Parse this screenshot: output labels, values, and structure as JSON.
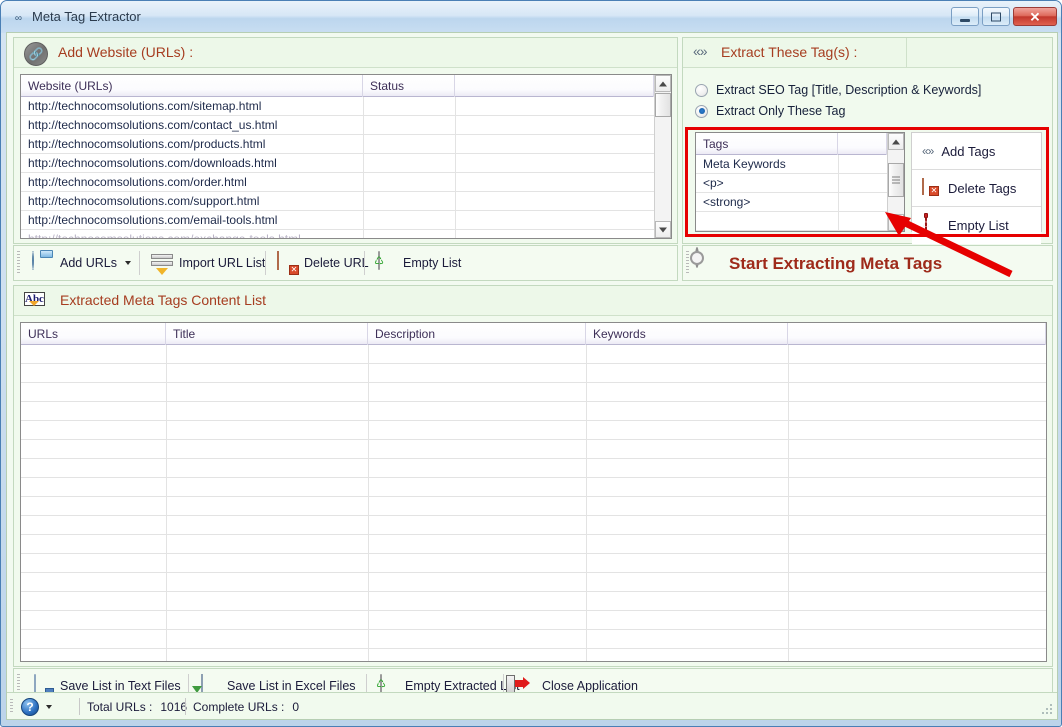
{
  "window": {
    "title": "Meta Tag Extractor",
    "title_icon": "app-icon",
    "minimize_label": "",
    "maximize_label": "",
    "close_label": "✕"
  },
  "add_website": {
    "header": "Add Website (URLs) :",
    "header_icon": "link-icon",
    "columns": [
      "Website (URLs)",
      "Status",
      ""
    ],
    "rows": [
      "http://technocomsolutions.com/sitemap.html",
      "http://technocomsolutions.com/contact_us.html",
      "http://technocomsolutions.com/products.html",
      "http://technocomsolutions.com/downloads.html",
      "http://technocomsolutions.com/order.html",
      "http://technocomsolutions.com/support.html",
      "http://technocomsolutions.com/email-tools.html",
      "http://technocomsolutions.com/exchange-tools.html"
    ]
  },
  "url_toolbar": {
    "items": [
      {
        "label": "Add URLs",
        "icon": "globe-add-icon",
        "has_caret": true
      },
      {
        "label": "Import URL List",
        "icon": "import-icon",
        "has_caret": false
      },
      {
        "label": "Delete URL",
        "icon": "delete-table-icon",
        "has_caret": false
      },
      {
        "label": "Empty List",
        "icon": "recycle-bin-icon",
        "has_caret": false
      }
    ]
  },
  "extract_tags": {
    "header": "Extract These Tag(s) :",
    "header_icon": "code-brackets-icon",
    "radios": [
      {
        "label": "Extract SEO Tag [Title, Description & Keywords]",
        "selected": false
      },
      {
        "label": "Extract Only These Tag",
        "selected": true
      }
    ],
    "tags_grid": {
      "columns": [
        "Tags",
        ""
      ],
      "rows": [
        "Meta Keywords",
        "<p>",
        "<strong>"
      ]
    },
    "buttons": [
      {
        "label": "Add Tags",
        "icon": "code-brackets-icon"
      },
      {
        "label": "Delete Tags",
        "icon": "delete-table-icon"
      },
      {
        "label": "Empty List",
        "icon": "trash-icon"
      }
    ]
  },
  "start_button": {
    "label": "Start Extracting Meta Tags",
    "icon": "gear-icon"
  },
  "extracted_list": {
    "header": "Extracted Meta Tags Content List",
    "header_icon": "abc-icon",
    "columns": [
      "URLs",
      "Title",
      "Description",
      "Keywords",
      ""
    ],
    "rows": []
  },
  "bottom_toolbar": {
    "items": [
      {
        "label": "Save List in Text Files",
        "icon": "text-file-save-icon"
      },
      {
        "label": "Save List in Excel Files",
        "icon": "excel-save-icon"
      },
      {
        "label": "Empty Extracted List",
        "icon": "recycle-bin-icon"
      },
      {
        "label": "Close Application",
        "icon": "exit-door-icon"
      }
    ]
  },
  "statusbar": {
    "help_icon": "help-icon",
    "total_urls_label": "Total URLs :",
    "total_urls_value": "1016",
    "complete_urls_label": "Complete URLs :",
    "complete_urls_value": "0"
  },
  "annotation": {
    "highlight_color": "#e60000"
  }
}
